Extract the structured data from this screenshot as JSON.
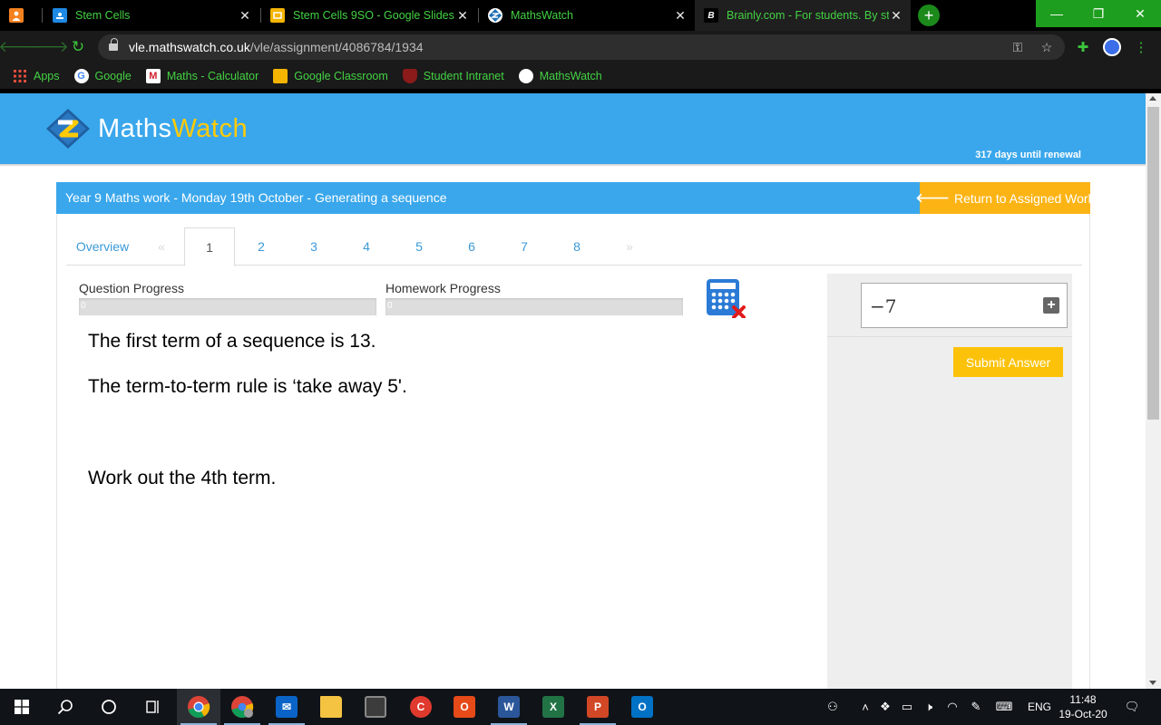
{
  "browser": {
    "tabs": [
      {
        "title": "",
        "favicon": "orange-person-icon",
        "color": "#f4811f"
      },
      {
        "title": "Stem Cells",
        "favicon": "google-classroom-icon",
        "color": "#1e88e5"
      },
      {
        "title": "Stem Cells 9SO - Google Slides",
        "favicon": "google-slides-icon",
        "color": "#f4b400"
      },
      {
        "title": "MathsWatch",
        "favicon": "mathswatch-icon",
        "color": "#3aa7ec"
      },
      {
        "title": "Brainly.com - For students. By stu",
        "favicon": "brainly-icon",
        "color": "#ffffff"
      }
    ],
    "url_host": "vle.mathswatch.co.uk",
    "url_path": "/vle/assignment/4086784/1934",
    "bookmarks": [
      {
        "label": "Apps",
        "icon": "apps-grid-icon"
      },
      {
        "label": "Google",
        "icon": "google-icon"
      },
      {
        "label": "Maths - Calculator",
        "icon": "maths-calculator-icon"
      },
      {
        "label": "Google Classroom",
        "icon": "google-classroom-icon"
      },
      {
        "label": "Student Intranet",
        "icon": "student-intranet-icon"
      },
      {
        "label": "MathsWatch",
        "icon": "mathswatch-icon"
      }
    ]
  },
  "header": {
    "logo_part1": "Maths",
    "logo_part2": "Watch",
    "renewal": "317 days until renewal",
    "brand_color": "#3aa7ec",
    "accent_color": "#fcb415"
  },
  "assignment": {
    "title": "Year 9 Maths work - Monday 19th October - Generating a sequence",
    "return_label": "Return to Assigned Work"
  },
  "tabs": {
    "overview": "Overview",
    "prev": "«",
    "next": "»",
    "questions": [
      "1",
      "2",
      "3",
      "4",
      "5",
      "6",
      "7",
      "8"
    ],
    "active_index": 0
  },
  "progress": {
    "question_label": "Question Progress",
    "question_value": "0",
    "question_fraction": 0,
    "homework_label": "Homework Progress",
    "homework_value": "0",
    "homework_fraction": 0
  },
  "question": {
    "line1": "The first term of a sequence is 13.",
    "line2": "The term-to-term rule is ‘take away 5'.",
    "line3": "Work out the 4th term."
  },
  "answer": {
    "value": "−7",
    "submit_label": "Submit Answer"
  },
  "taskbar": {
    "language": "ENG",
    "time": "11:48",
    "date": "19-Oct-20"
  }
}
